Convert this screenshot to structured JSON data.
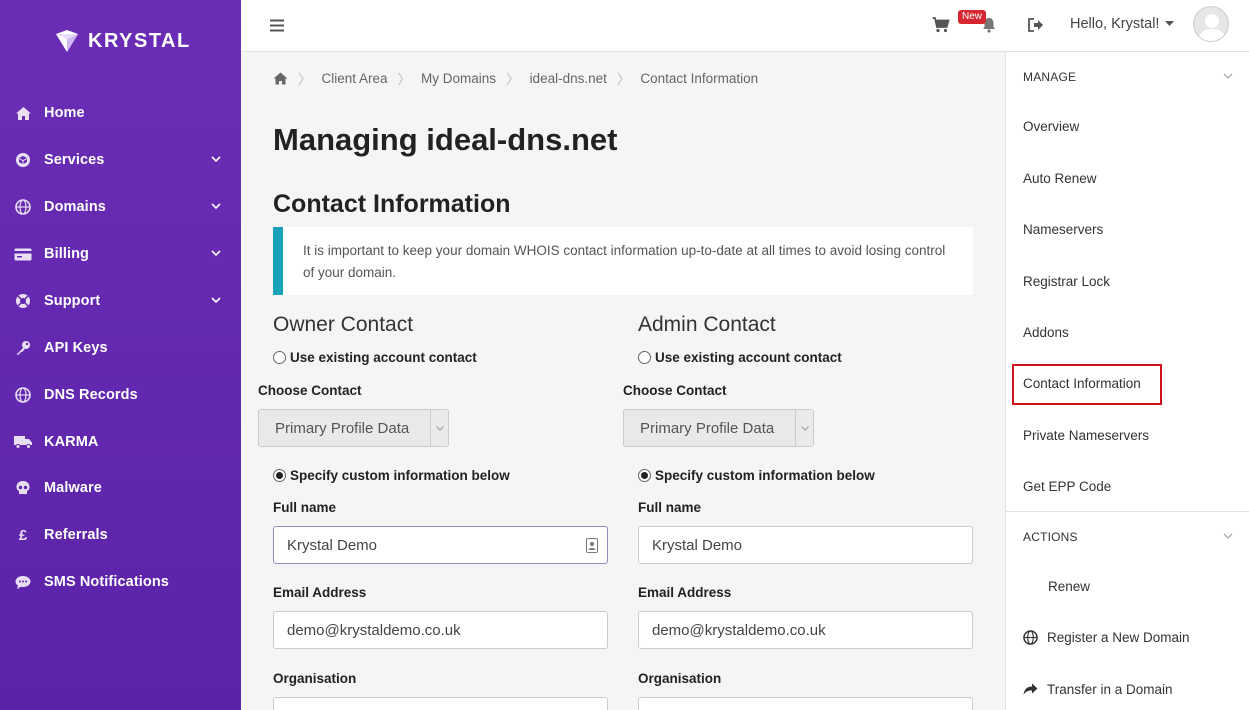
{
  "brand": {
    "name": "KRYSTAL"
  },
  "sidebar": {
    "items": [
      {
        "label": "Home",
        "icon": "home-icon"
      },
      {
        "label": "Services",
        "icon": "cube-icon",
        "expandable": true
      },
      {
        "label": "Domains",
        "icon": "globe-icon",
        "expandable": true
      },
      {
        "label": "Billing",
        "icon": "credit-card-icon",
        "expandable": true
      },
      {
        "label": "Support",
        "icon": "lifebuoy-icon",
        "expandable": true
      },
      {
        "label": "API Keys",
        "icon": "key-icon"
      },
      {
        "label": "DNS Records",
        "icon": "globe-icon"
      },
      {
        "label": "KARMA",
        "icon": "truck-icon"
      },
      {
        "label": "Malware",
        "icon": "skull-icon"
      },
      {
        "label": "Referrals",
        "icon": "pound-icon"
      },
      {
        "label": "SMS Notifications",
        "icon": "chat-icon"
      }
    ]
  },
  "topbar": {
    "badge": "New",
    "greeting": "Hello, Krystal!"
  },
  "breadcrumb": [
    "Client Area",
    "My Domains",
    "ideal-dns.net",
    "Contact Information"
  ],
  "page": {
    "title": "Managing ideal-dns.net",
    "section_title": "Contact Information",
    "alert": "It is important to keep your domain WHOIS contact information up-to-date at all times to avoid losing control of your domain."
  },
  "owner": {
    "title": "Owner Contact",
    "use_existing": "Use existing account contact",
    "choose_contact_label": "Choose Contact",
    "choose_contact_value": "Primary Profile Data",
    "specify_custom": "Specify custom information below",
    "full_name_label": "Full name",
    "full_name_value": "Krystal Demo",
    "email_label": "Email Address",
    "email_value": "demo@krystaldemo.co.uk",
    "org_label": "Organisation",
    "selected_option": "custom"
  },
  "admin": {
    "title": "Admin Contact",
    "use_existing": "Use existing account contact",
    "choose_contact_label": "Choose Contact",
    "choose_contact_value": "Primary Profile Data",
    "specify_custom": "Specify custom information below",
    "full_name_label": "Full name",
    "full_name_value": "Krystal Demo",
    "email_label": "Email Address",
    "email_value": "demo@krystaldemo.co.uk",
    "org_label": "Organisation",
    "selected_option": "custom"
  },
  "manage_panel": {
    "heading": "MANAGE",
    "items": [
      "Overview",
      "Auto Renew",
      "Nameservers",
      "Registrar Lock",
      "Addons",
      "Contact Information",
      "Private Nameservers",
      "Get EPP Code"
    ],
    "active": "Contact Information",
    "actions_heading": "ACTIONS",
    "actions": [
      {
        "label": "Renew",
        "icon": ""
      },
      {
        "label": "Register a New Domain",
        "icon": "globe-icon"
      },
      {
        "label": "Transfer in a Domain",
        "icon": "share-icon"
      }
    ]
  },
  "colors": {
    "sidebar": "#6328b0",
    "alert_accent": "#17a2b8",
    "badge": "#d7262f",
    "highlight": "#d0101a"
  }
}
